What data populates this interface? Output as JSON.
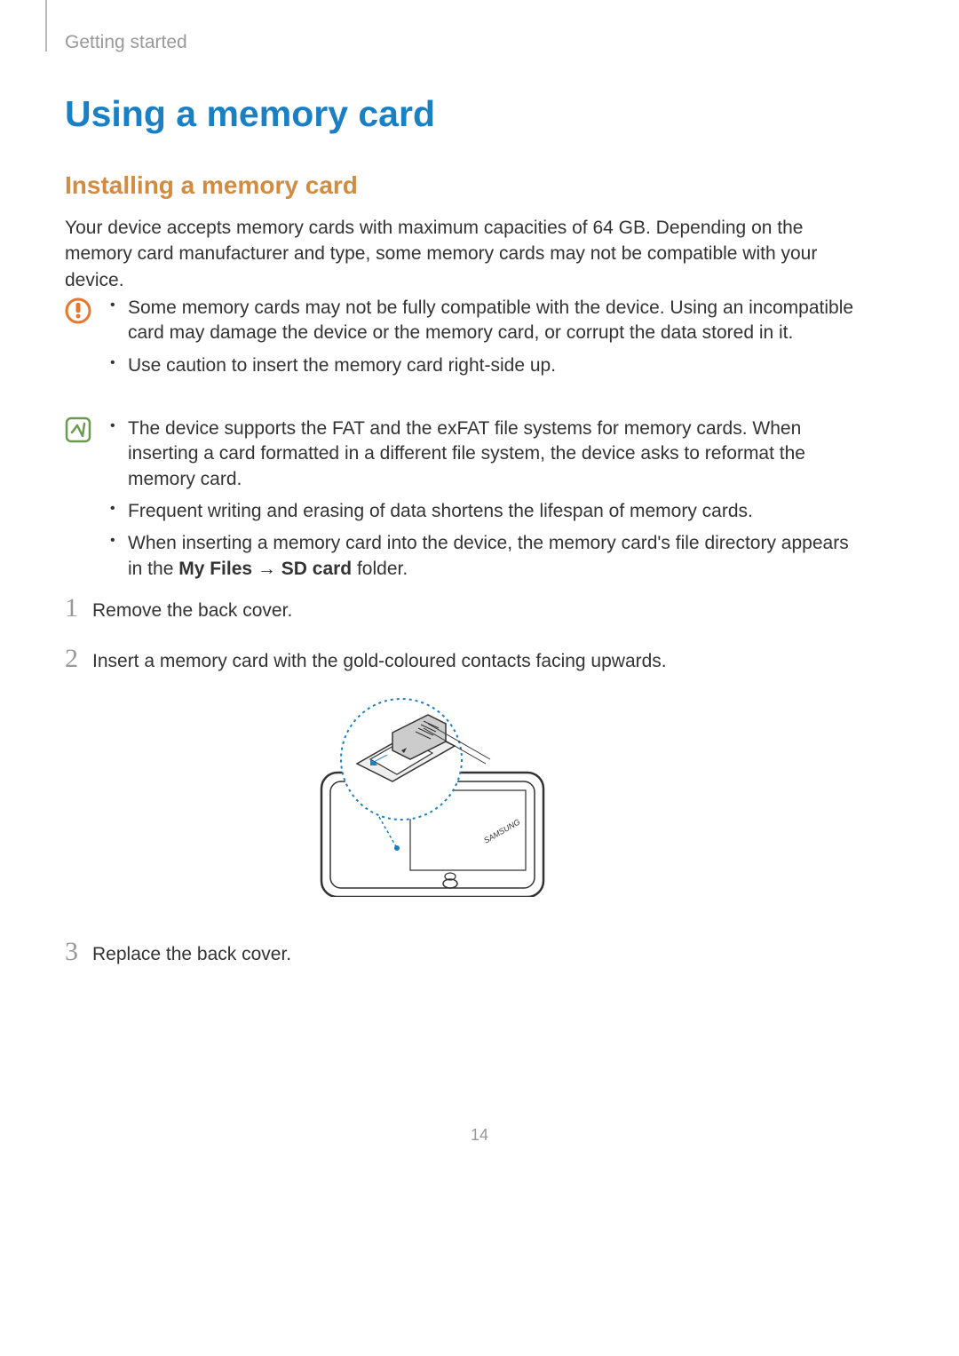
{
  "header": {
    "section": "Getting started"
  },
  "headings": {
    "main": "Using a memory card",
    "sub": "Installing a memory card"
  },
  "intro": "Your device accepts memory cards with maximum capacities of 64 GB. Depending on the memory card manufacturer and type, some memory cards may not be compatible with your device.",
  "caution": {
    "items": [
      "Some memory cards may not be fully compatible with the device. Using an incompatible card may damage the device or the memory card, or corrupt the data stored in it.",
      "Use caution to insert the memory card right-side up."
    ]
  },
  "note": {
    "items": [
      "The device supports the FAT and the exFAT file systems for memory cards. When inserting a card formatted in a different file system, the device asks to reformat the memory card.",
      "Frequent writing and erasing of data shortens the lifespan of memory cards."
    ],
    "item3_prefix": "When inserting a memory card into the device, the memory card's file directory appears in the ",
    "item3_bold1": "My Files",
    "item3_arrow": " → ",
    "item3_bold2": "SD card",
    "item3_suffix": " folder."
  },
  "steps": {
    "num1": "1",
    "text1": "Remove the back cover.",
    "num2": "2",
    "text2": "Insert a memory card with the gold-coloured contacts facing upwards.",
    "num3": "3",
    "text3": "Replace the back cover."
  },
  "pageNumber": "14"
}
